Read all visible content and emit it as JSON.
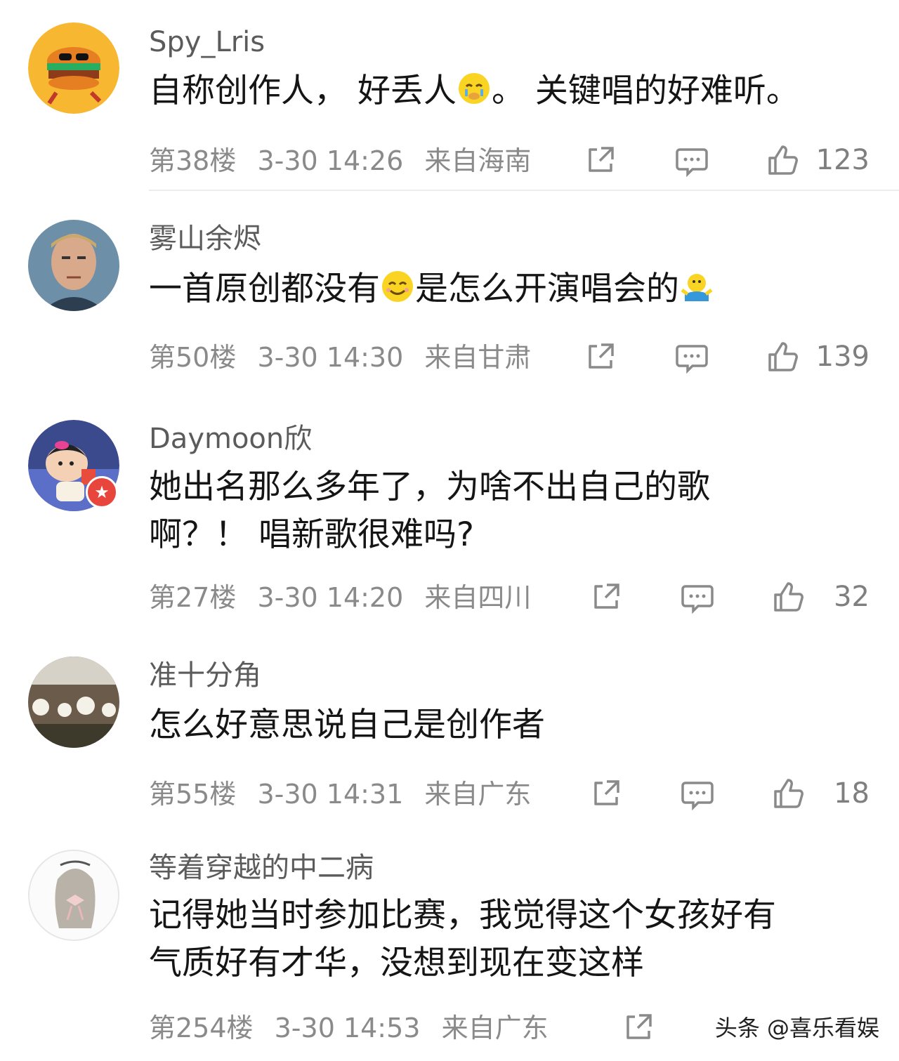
{
  "comments": [
    {
      "username": "Spy_Lris",
      "text_parts": [
        "自称创作人， 好丢人",
        "。 关键唱的好难听。"
      ],
      "floor": "第38楼",
      "time": "3-30 14:26",
      "location": "来自海南",
      "likes": "123",
      "avatar_icon": "burger-avatar",
      "emoji": "crying-face-emoji"
    },
    {
      "username": "雾山余烬",
      "text_parts": [
        "一首原创都没有",
        "是怎么开演唱会的"
      ],
      "floor": "第50楼",
      "time": "3-30 14:30",
      "location": "来自甘肃",
      "likes": "139",
      "avatar_icon": "man-portrait-avatar",
      "emoji": "smile-emoji"
    },
    {
      "username": "Daymoon欣",
      "text_lines": [
        "她出名那么多年了，为啥不出自己的歌",
        "啊？！ 唱新歌很难吗?"
      ],
      "floor": "第27楼",
      "time": "3-30 14:20",
      "location": "来自四川",
      "likes": "32",
      "avatar_icon": "cartoon-girl-avatar"
    },
    {
      "username": "准十分角",
      "text": "怎么好意思说自己是创作者",
      "floor": "第55楼",
      "time": "3-30 14:31",
      "location": "来自广东",
      "likes": "18",
      "avatar_icon": "restaurant-photo-avatar"
    },
    {
      "username": "等着穿越的中二病",
      "text_lines": [
        "记得她当时参加比赛，我觉得这个女孩好有",
        "气质好有才华，没想到现在变这样"
      ],
      "floor": "第254楼",
      "time": "3-30 14:53",
      "location": "来自广东",
      "avatar_icon": "girl-sketch-avatar"
    }
  ],
  "icons": {
    "share": "share-icon",
    "reply": "comment-icon",
    "like": "thumbs-up-icon"
  },
  "watermark": "头条 @喜乐看娱",
  "colors": {
    "text": "#151515",
    "username": "#5b5b5b",
    "meta": "#8a8a8a",
    "divider": "#ececec"
  }
}
